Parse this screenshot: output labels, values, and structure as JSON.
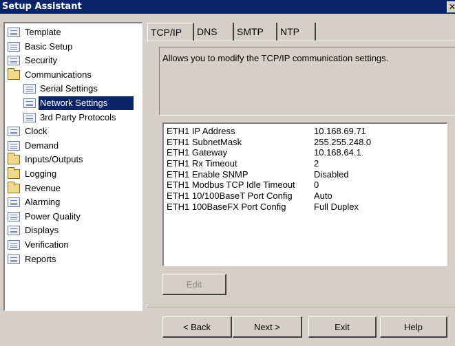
{
  "window": {
    "title": "Setup Assistant",
    "close_glyph": "✕"
  },
  "tree": {
    "items": [
      {
        "label": "Template",
        "icon": "document-icon",
        "level": 0
      },
      {
        "label": "Basic Setup",
        "icon": "document-icon",
        "level": 0
      },
      {
        "label": "Security",
        "icon": "document-icon",
        "level": 0
      },
      {
        "label": "Communications",
        "icon": "folder-icon",
        "level": 0
      },
      {
        "label": "Serial Settings",
        "icon": "document-icon",
        "level": 1
      },
      {
        "label": "Network Settings",
        "icon": "document-icon",
        "level": 1,
        "selected": true
      },
      {
        "label": "3rd Party Protocols",
        "icon": "document-icon",
        "level": 1
      },
      {
        "label": "Clock",
        "icon": "document-icon",
        "level": 0
      },
      {
        "label": "Demand",
        "icon": "document-icon",
        "level": 0
      },
      {
        "label": "Inputs/Outputs",
        "icon": "folder-icon",
        "level": 0
      },
      {
        "label": "Logging",
        "icon": "folder-icon",
        "level": 0
      },
      {
        "label": "Revenue",
        "icon": "folder-icon",
        "level": 0
      },
      {
        "label": "Alarming",
        "icon": "document-icon",
        "level": 0
      },
      {
        "label": "Power Quality",
        "icon": "document-icon",
        "level": 0
      },
      {
        "label": "Displays",
        "icon": "document-icon",
        "level": 0
      },
      {
        "label": "Verification",
        "icon": "document-icon",
        "level": 0
      },
      {
        "label": "Reports",
        "icon": "document-icon",
        "level": 0
      }
    ]
  },
  "tabs": [
    {
      "label": "TCP/IP",
      "active": true
    },
    {
      "label": "DNS"
    },
    {
      "label": "SMTP"
    },
    {
      "label": "NTP"
    }
  ],
  "description": "Allows you to modify the TCP/IP communication settings.",
  "settings": [
    {
      "name": "ETH1 IP Address",
      "value": "10.168.69.71"
    },
    {
      "name": "ETH1 SubnetMask",
      "value": "255.255.248.0"
    },
    {
      "name": "ETH1 Gateway",
      "value": "10.168.64.1"
    },
    {
      "name": "ETH1 Rx Timeout",
      "value": "2"
    },
    {
      "name": "ETH1 Enable SNMP",
      "value": "Disabled"
    },
    {
      "name": "ETH1 Modbus TCP Idle Timeout",
      "value": "0"
    },
    {
      "name": "ETH1 10/100BaseT Port Config",
      "value": "Auto"
    },
    {
      "name": "ETH1 100BaseFX Port Config",
      "value": "Full Duplex"
    }
  ],
  "buttons": {
    "edit": "Edit",
    "back": "< Back",
    "next": "Next >",
    "exit": "Exit",
    "help": "Help"
  },
  "colors": {
    "titlebar": "#0a246a",
    "selection": "#0a246a",
    "face": "#d4d0c8"
  }
}
